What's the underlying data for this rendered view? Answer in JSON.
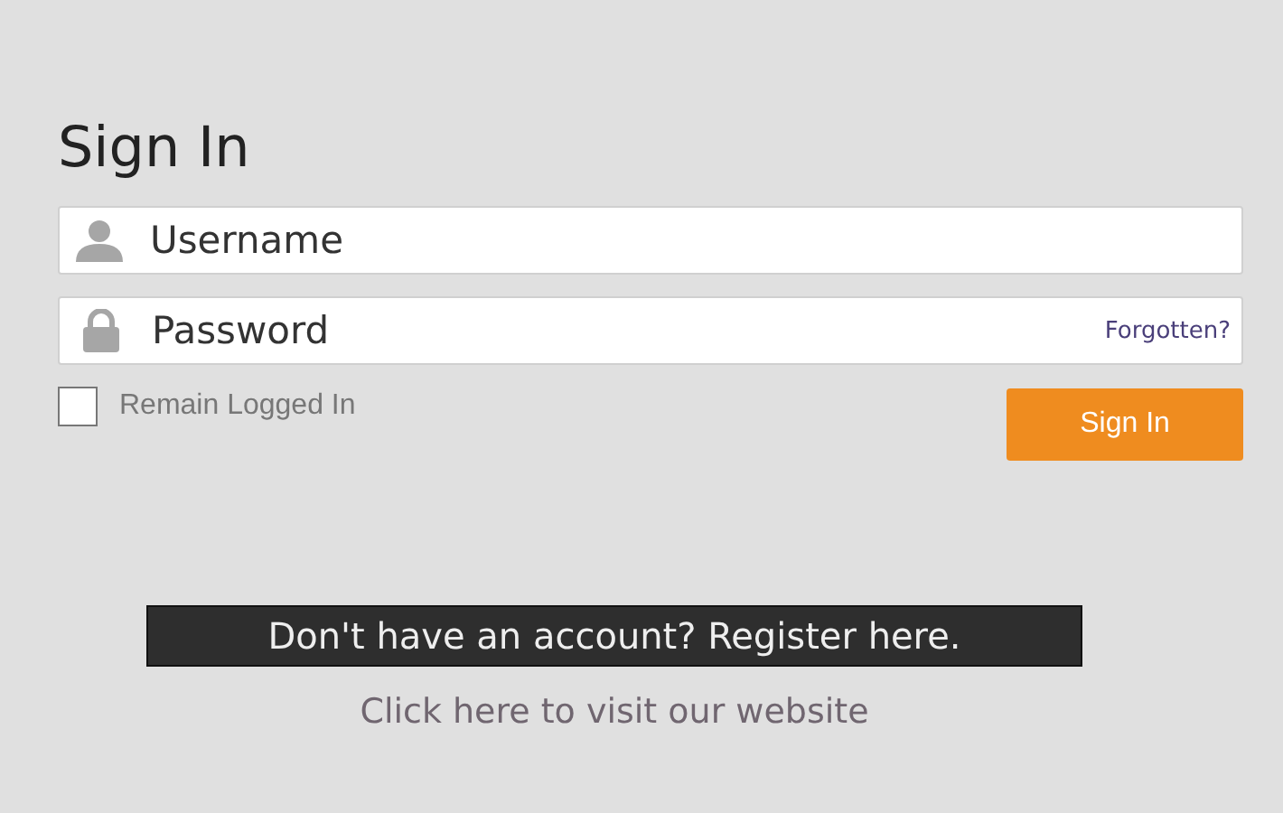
{
  "title": "Sign In",
  "username": {
    "placeholder": "Username"
  },
  "password": {
    "placeholder": "Password",
    "forgot_link": "Forgotten?"
  },
  "remember": {
    "label": "Remain Logged In",
    "checked": false
  },
  "sign_in_button": "Sign In",
  "register_button": "Don't have an account? Register here.",
  "website_link": "Click here to visit our website"
}
